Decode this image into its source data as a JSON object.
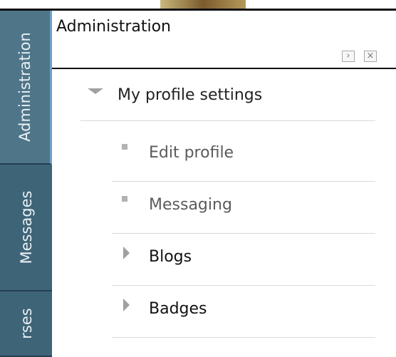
{
  "dock": {
    "tabs": [
      {
        "label": "Administration"
      },
      {
        "label": "Messages"
      },
      {
        "label": "rses"
      }
    ]
  },
  "block": {
    "title": "Administration",
    "buttons": {
      "dock_glyph": "›",
      "close_glyph": "×"
    }
  },
  "tree": {
    "root": {
      "label": "My profile settings",
      "icon": "expanded-arrow-icon"
    },
    "children": [
      {
        "label": "Edit profile",
        "icon": "bullet-square-icon"
      },
      {
        "label": "Messaging",
        "icon": "bullet-square-icon"
      },
      {
        "label": "Blogs",
        "icon": "collapsed-arrow-icon"
      },
      {
        "label": "Badges",
        "icon": "collapsed-arrow-icon"
      }
    ]
  },
  "colors": {
    "dock_bg": "#2f5066",
    "tab_bg": "#3e6478",
    "link_text": "#5b5b5b"
  }
}
